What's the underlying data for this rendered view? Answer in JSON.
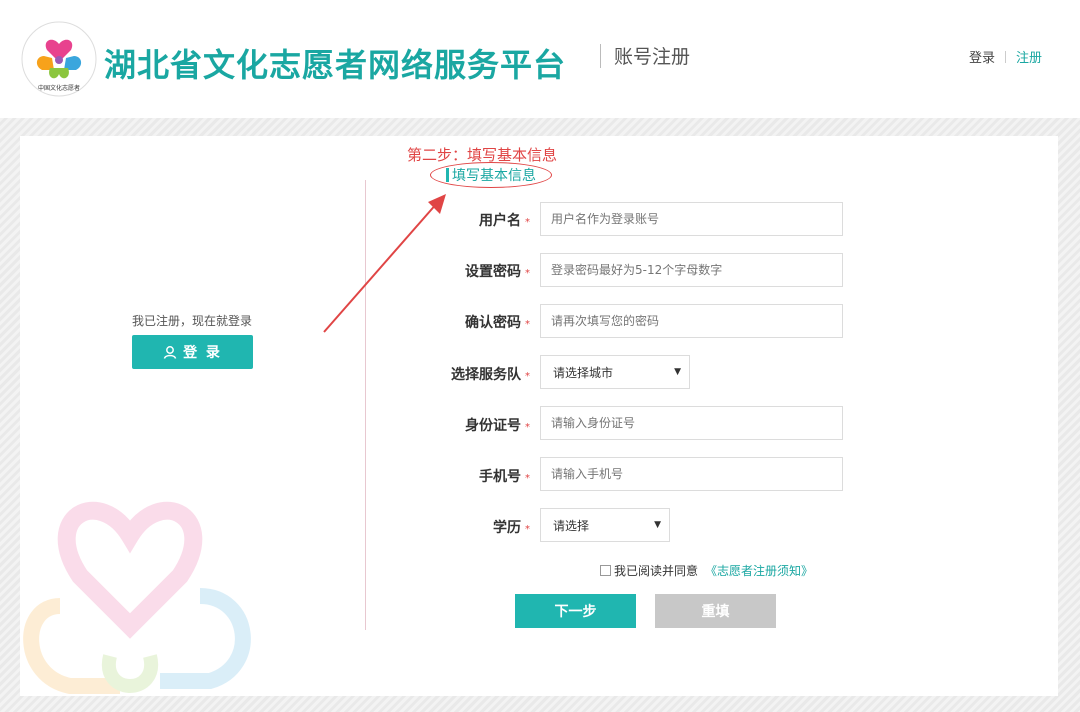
{
  "header": {
    "site_title": "湖北省文化志愿者网络服务平台",
    "page_subtitle": "账号注册",
    "logo_text": "CHINA CULTURAL SERVICE VOLUNTEERS 中国文化志愿者",
    "nav": {
      "login": "登录",
      "register": "注册"
    }
  },
  "left_panel": {
    "hint": "我已注册，现在就登录",
    "login_button": "登 录",
    "login_icon": "user-icon"
  },
  "step": {
    "title": "第二步：填写基本信息",
    "section_tab": "填写基本信息"
  },
  "form": {
    "required_mark": "*",
    "fields": [
      {
        "label": "用户名",
        "placeholder": "用户名作为登录账号"
      },
      {
        "label": "设置密码",
        "placeholder": "登录密码最好为5-12个字母数字"
      },
      {
        "label": "确认密码",
        "placeholder": "请再次填写您的密码"
      },
      {
        "label": "选择服务队",
        "selected": "请选择城市"
      },
      {
        "label": "身份证号",
        "placeholder": "请输入身份证号"
      },
      {
        "label": "手机号",
        "placeholder": "请输入手机号"
      },
      {
        "label": "学历",
        "selected": "请选择"
      }
    ],
    "agree_text": "我已阅读并同意",
    "agree_link": "《志愿者注册须知》",
    "next_button": "下一步",
    "reset_button": "重填"
  },
  "colors": {
    "accent": "#20b6b0",
    "highlight_red": "#e04545",
    "disabled_gray": "#c8c8c8"
  }
}
